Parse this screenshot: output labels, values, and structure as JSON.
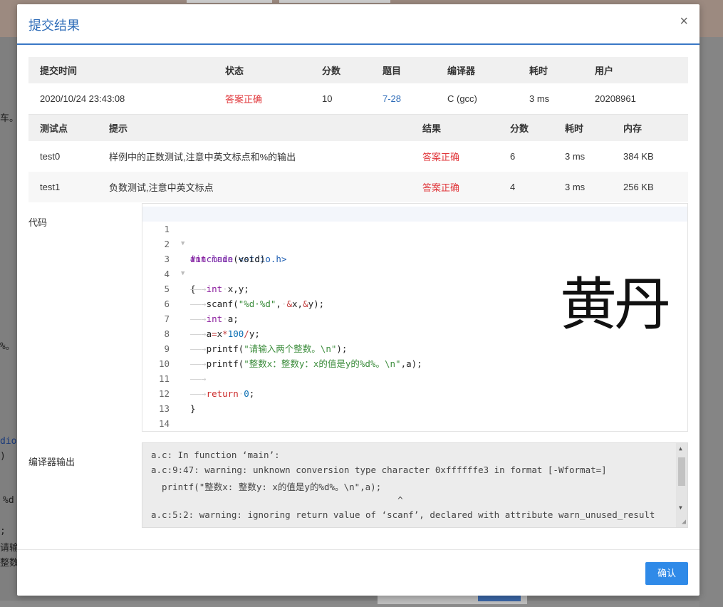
{
  "background": {
    "fragments": [
      "车。",
      "%。",
      "dio.h",
      ")",
      "%d",
      ";",
      "请输入",
      "整数x"
    ]
  },
  "modal": {
    "title": "提交结果",
    "close_symbol": "×",
    "confirm_label": "确认"
  },
  "summary_table": {
    "headers": [
      "提交时间",
      "状态",
      "分数",
      "题目",
      "编译器",
      "耗时",
      "用户"
    ],
    "row": {
      "time": "2020/10/24 23:43:08",
      "status": "答案正确",
      "score": "10",
      "problem": "7-28",
      "compiler": "C (gcc)",
      "duration": "3 ms",
      "user": "20208961"
    }
  },
  "testcase_table": {
    "headers": [
      "测试点",
      "提示",
      "结果",
      "分数",
      "耗时",
      "内存"
    ],
    "rows": [
      {
        "id": "test0",
        "hint": "样例中的正数测试,注意中英文标点和%的输出",
        "result": "答案正确",
        "score": "6",
        "duration": "3 ms",
        "memory": "384 KB"
      },
      {
        "id": "test1",
        "hint": "负数测试,注意中英文标点",
        "result": "答案正确",
        "score": "4",
        "duration": "3 ms",
        "memory": "256 KB"
      }
    ]
  },
  "code_section": {
    "label": "代码",
    "line_numbers": [
      "1",
      "2",
      "3",
      "4",
      "5",
      "6",
      "7",
      "8",
      "9",
      "10",
      "11",
      "12",
      "13",
      "14"
    ]
  },
  "watermark_text": "黄丹",
  "compiler_output": {
    "label": "编译器输出",
    "lines": [
      "a.c: In function ‘main’:",
      "a.c:9:47: warning: unknown conversion type character 0xffffffe3 in format [-Wformat=]",
      "  printf(\"整数x: 整数y: x的值是y的%d%。\\n\",a);",
      "                                              ^",
      "a.c:5:2: warning: ignoring return value of ‘scanf’, declared with attribute warn_unused_result"
    ]
  },
  "colors": {
    "accent": "#2e6cb8",
    "status_ok": "#e0363a",
    "confirm_button": "#2f8ae8"
  }
}
